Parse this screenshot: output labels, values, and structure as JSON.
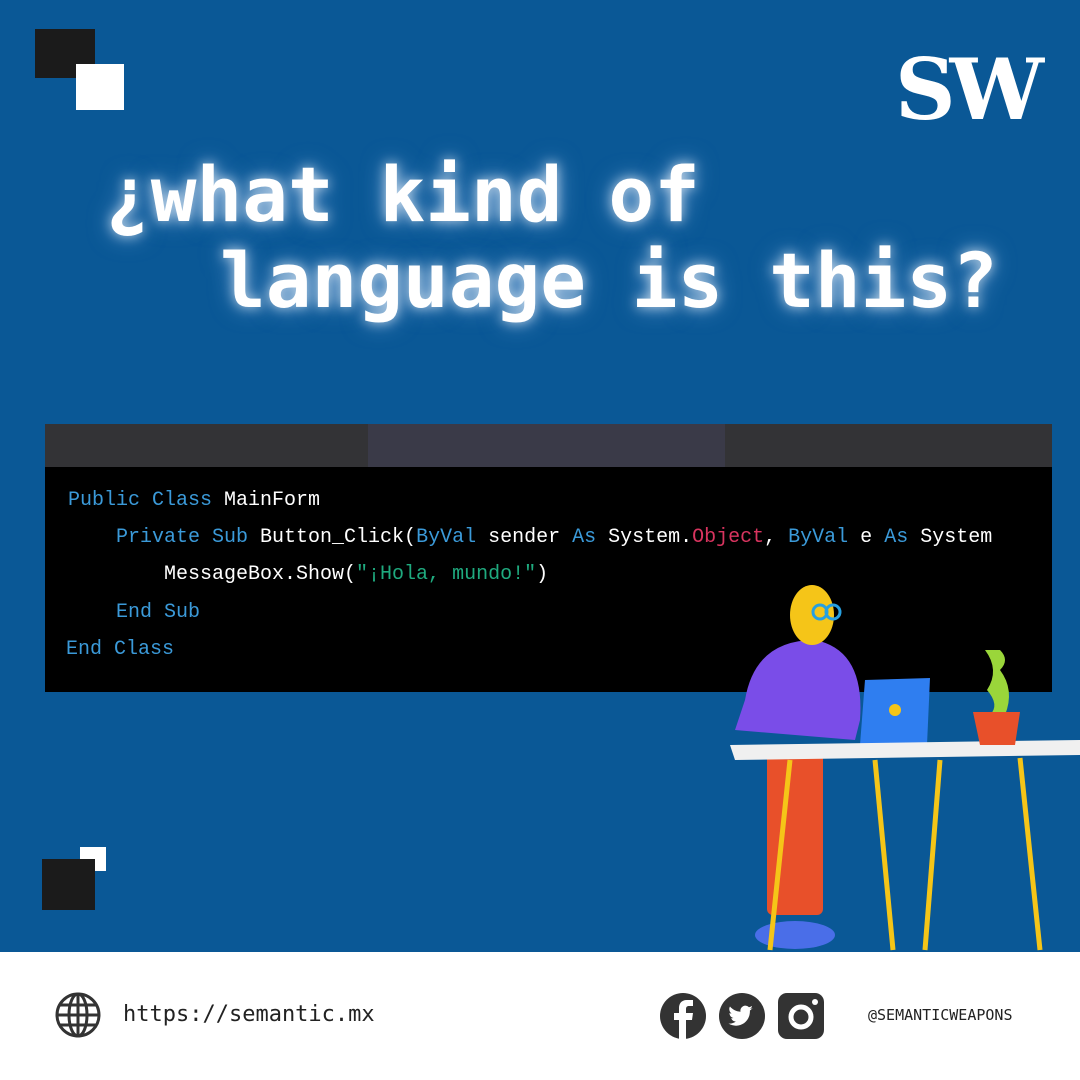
{
  "brand": {
    "logo": "SW"
  },
  "headline": {
    "line1": "¿what kind of",
    "line2": "language is this?"
  },
  "code": {
    "lines": [
      [
        {
          "t": "Public Class",
          "c": "kw"
        },
        {
          "t": " MainForm",
          "c": ""
        }
      ],
      [
        {
          "t": "    Private Sub",
          "c": "kw"
        },
        {
          "t": " Button_Click(",
          "c": ""
        },
        {
          "t": "ByVal",
          "c": "kw"
        },
        {
          "t": " sender ",
          "c": ""
        },
        {
          "t": "As",
          "c": "kw"
        },
        {
          "t": " System.",
          "c": ""
        },
        {
          "t": "Object",
          "c": "ty"
        },
        {
          "t": ", ",
          "c": ""
        },
        {
          "t": "ByVal",
          "c": "kw"
        },
        {
          "t": " e ",
          "c": ""
        },
        {
          "t": "As",
          "c": "kw"
        },
        {
          "t": " System",
          "c": ""
        }
      ],
      [
        {
          "t": "        MessageBox.Show(",
          "c": ""
        },
        {
          "t": "\"¡Hola, mundo!\"",
          "c": "st"
        },
        {
          "t": ")",
          "c": ""
        }
      ],
      [
        {
          "t": "    End Sub",
          "c": "kw"
        }
      ],
      [
        {
          "t": "End Class",
          "c": "kw"
        }
      ]
    ]
  },
  "footer": {
    "url": "https://semantic.mx",
    "handle": "@SEMANTICWEAPONS",
    "icons": [
      "globe-icon",
      "facebook-icon",
      "twitter-icon",
      "instagram-icon"
    ]
  },
  "colors": {
    "background": "#0a5896",
    "keyword": "#3b9ad9",
    "type": "#d8345f",
    "string": "#1faa7f"
  }
}
